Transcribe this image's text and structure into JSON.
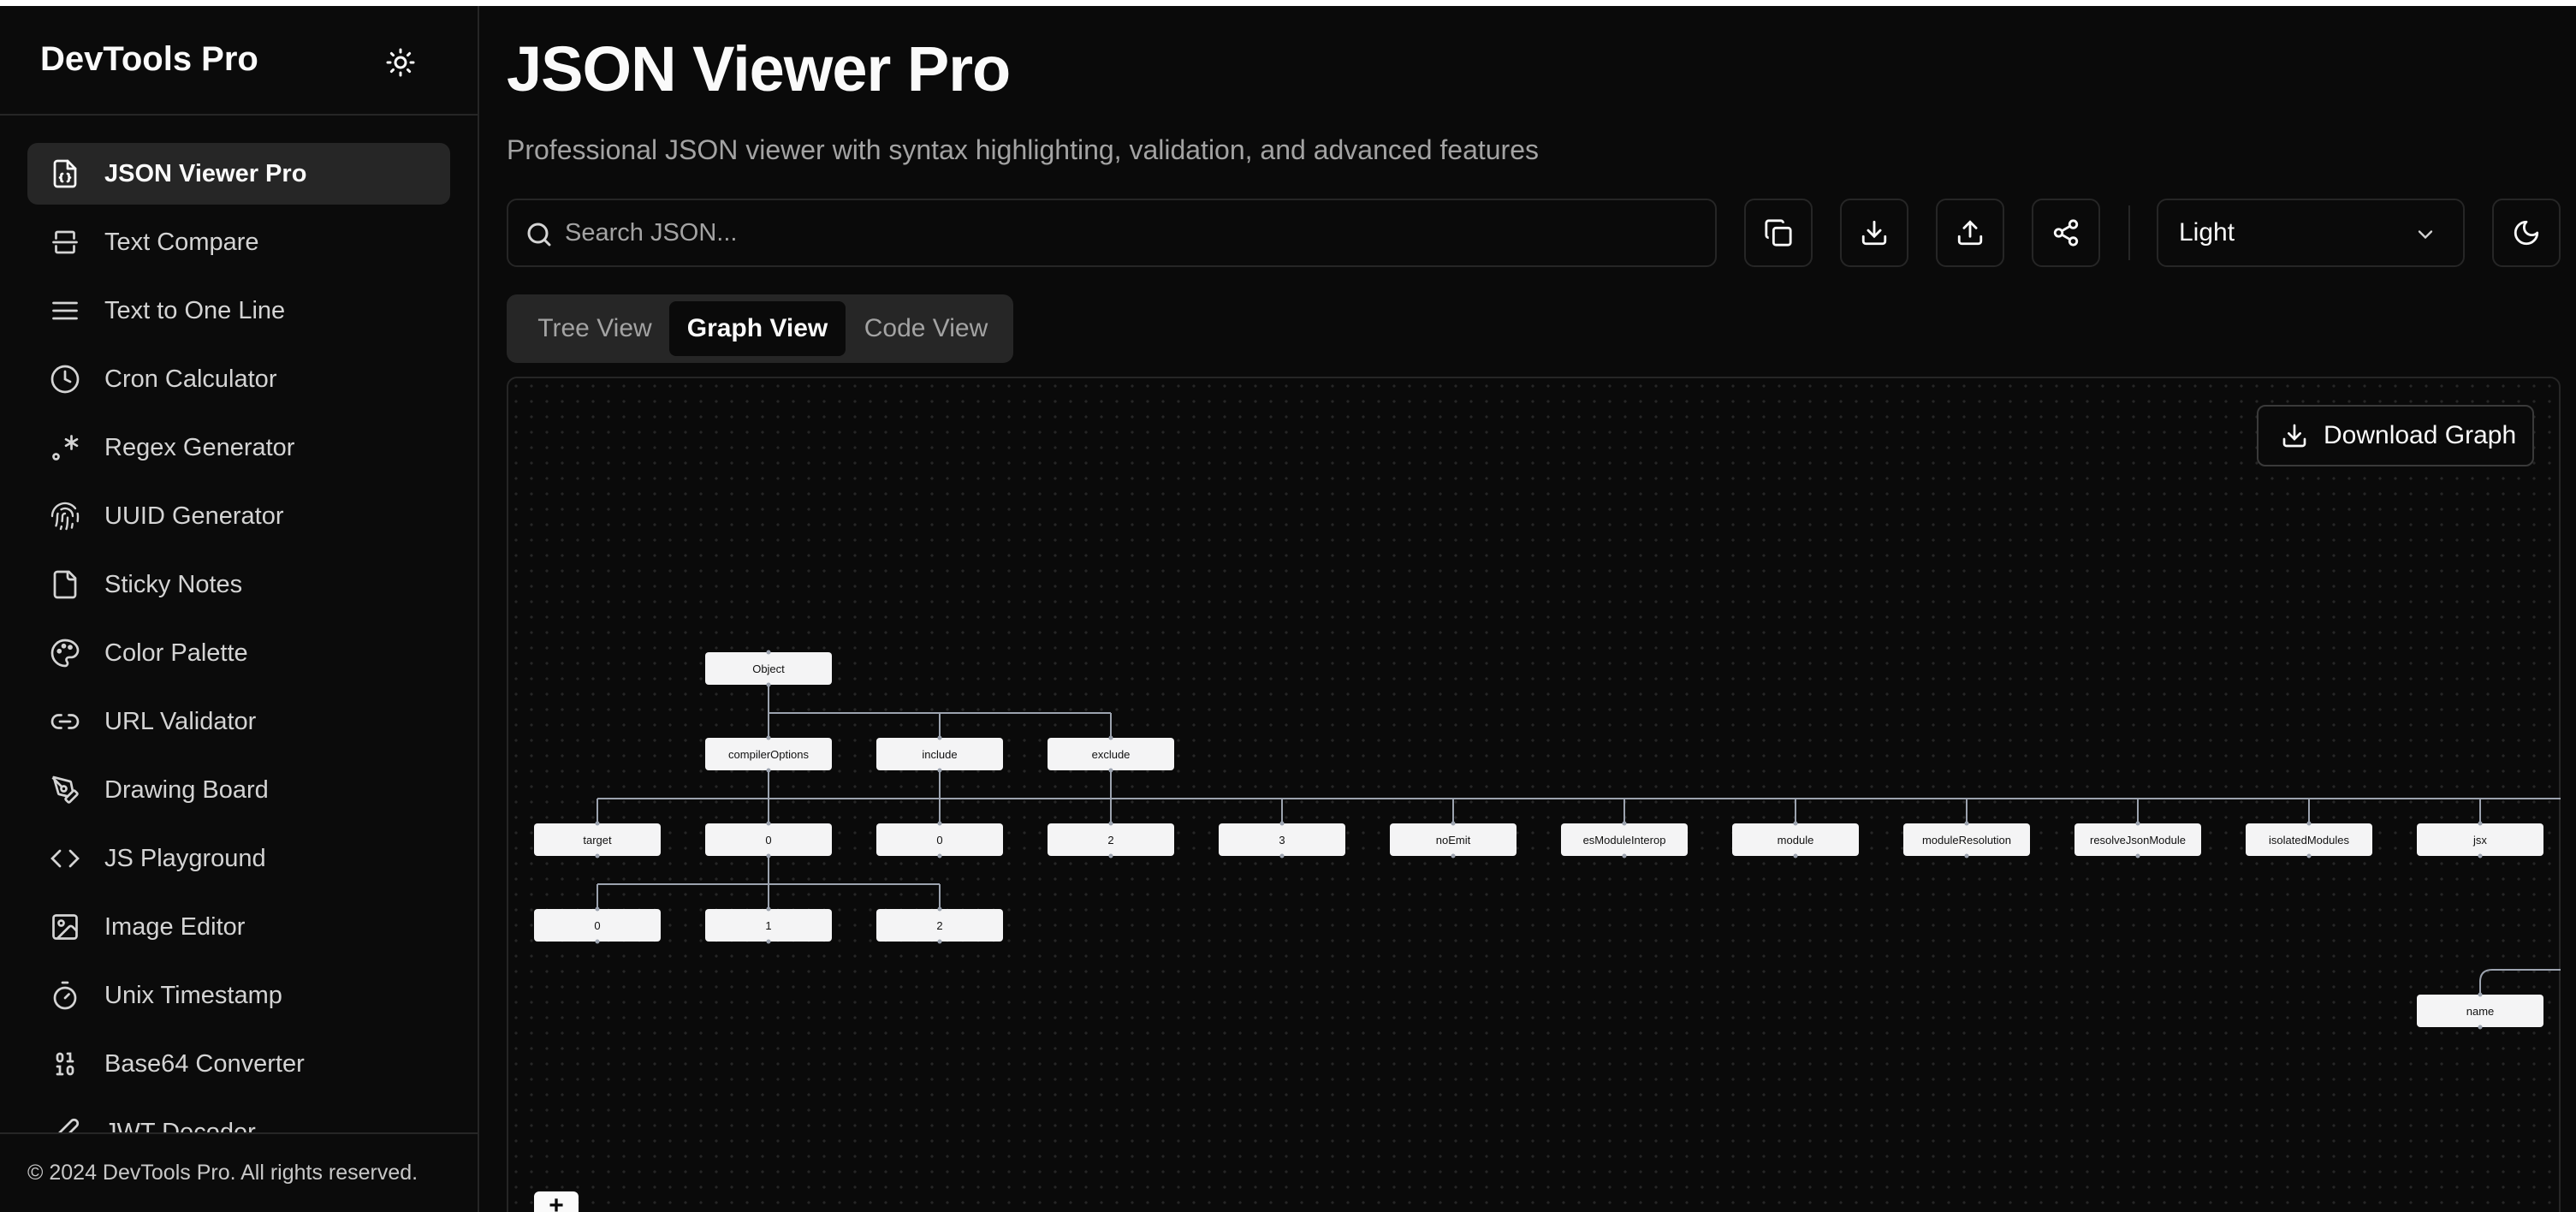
{
  "sidebar": {
    "brand": "DevTools Pro",
    "items": [
      {
        "label": "JSON Viewer Pro",
        "icon": "file-json-icon",
        "active": true
      },
      {
        "label": "Text Compare",
        "icon": "split-icon",
        "active": false
      },
      {
        "label": "Text to One Line",
        "icon": "lines-icon",
        "active": false
      },
      {
        "label": "Cron Calculator",
        "icon": "clock-icon",
        "active": false
      },
      {
        "label": "Regex Generator",
        "icon": "regex-icon",
        "active": false
      },
      {
        "label": "UUID Generator",
        "icon": "fingerprint-icon",
        "active": false
      },
      {
        "label": "Sticky Notes",
        "icon": "sticky-note-icon",
        "active": false
      },
      {
        "label": "Color Palette",
        "icon": "palette-icon",
        "active": false
      },
      {
        "label": "URL Validator",
        "icon": "link-icon",
        "active": false
      },
      {
        "label": "Drawing Board",
        "icon": "pen-tool-icon",
        "active": false
      },
      {
        "label": "JS Playground",
        "icon": "code-icon",
        "active": false
      },
      {
        "label": "Image Editor",
        "icon": "image-icon",
        "active": false
      },
      {
        "label": "Unix Timestamp",
        "icon": "timer-icon",
        "active": false
      },
      {
        "label": "Base64 Converter",
        "icon": "binary-icon",
        "active": false
      },
      {
        "label": "JWT Decoder",
        "icon": "pen-icon",
        "active": false
      }
    ],
    "footer": "© 2024 DevTools Pro. All rights reserved."
  },
  "main": {
    "title": "JSON Viewer Pro",
    "subtitle": "Professional JSON viewer with syntax highlighting, validation, and advanced features",
    "search": {
      "placeholder": "Search JSON...",
      "value": ""
    },
    "theme_select": {
      "value": "Light"
    },
    "tabs": [
      {
        "label": "Tree View",
        "active": false
      },
      {
        "label": "Graph View",
        "active": true
      },
      {
        "label": "Code View",
        "active": false
      }
    ],
    "download_label": "Download Graph",
    "zoom_label": "+"
  },
  "graph": {
    "root": "Object",
    "level1": [
      "compilerOptions",
      "include",
      "exclude"
    ],
    "level2": [
      "target",
      "0",
      "0",
      "2",
      "3",
      "noEmit",
      "esModuleInterop",
      "module",
      "moduleResolution",
      "resolveJsonModule",
      "isolatedModules",
      "jsx"
    ],
    "level3": [
      "0",
      "1",
      "2"
    ],
    "extra": [
      "name"
    ]
  },
  "colors": {
    "background": "#0a0a0a",
    "border": "#262626",
    "node_fill": "#f4f4f5",
    "edge": "#9ca3af",
    "text": "#fafafa",
    "muted": "#a3a3a3"
  }
}
